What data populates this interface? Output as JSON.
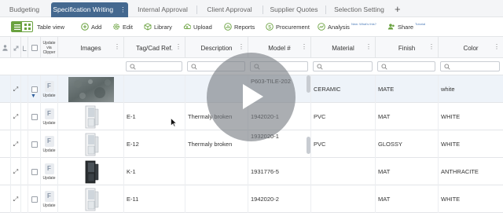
{
  "tabs": [
    {
      "label": "Budgeting",
      "active": false
    },
    {
      "label": "Specification Writing",
      "active": true
    },
    {
      "label": "Internal Approval",
      "active": false
    },
    {
      "label": "Client Approval",
      "active": false
    },
    {
      "label": "Supplier Quotes",
      "active": false
    },
    {
      "label": "Selection Setting",
      "active": false
    }
  ],
  "tab_menu_glyph": "⋮",
  "add_tab_glyph": "+",
  "toolbar": {
    "table_view": "Table view",
    "add": "Add",
    "edit": "Edit",
    "library": "Library",
    "upload": "Upload",
    "reports": "Reports",
    "procurement": "Procurement",
    "analysis": "Analysis",
    "analysis_sup": "New: What's this?",
    "share": "Share",
    "share_sup": "Tutorial"
  },
  "columns": {
    "update_via_clipper": [
      "Update",
      "via",
      "Clipper"
    ],
    "images": "Images",
    "tag": "Tag/Cad Ref.",
    "description": "Description",
    "model": "Model #",
    "material": "Material",
    "finish": "Finish",
    "color": "Color"
  },
  "column_menu_glyph": "⋮",
  "update_label": "Update",
  "file_letter": "F",
  "expand_glyph": "⤢",
  "rows": [
    {
      "tag": "",
      "description": "",
      "model": "P603-TILE-202",
      "material": "CERAMIC",
      "finish": "MATE",
      "color": "white",
      "image": "stone-tile"
    },
    {
      "tag": "E-1",
      "description": "Thermaly broken",
      "model": "1942020-1",
      "material": "PVC",
      "finish": "MAT",
      "color": "WHITE",
      "image": "white-window-profile"
    },
    {
      "tag": "E-12",
      "description": "Thermaly broken",
      "model": "1932020-1",
      "material": "PVC",
      "finish": "GLOSSY",
      "color": "WHITE",
      "image": "white-window-profile"
    },
    {
      "tag": "K-1",
      "description": "",
      "model": "1931776-5",
      "material": "",
      "finish": "MAT",
      "color": "ANTHRACITE",
      "image": "dark-window-profile"
    },
    {
      "tag": "E-11",
      "description": "",
      "model": "1942020-2",
      "material": "",
      "finish": "MAT",
      "color": "WHITE",
      "image": "white-window-profile"
    }
  ],
  "colors": {
    "active_tab": "#44688f",
    "accent_green": "#6aa23f",
    "selected_row": "#eef3f9",
    "play_overlay": "#787c82"
  }
}
